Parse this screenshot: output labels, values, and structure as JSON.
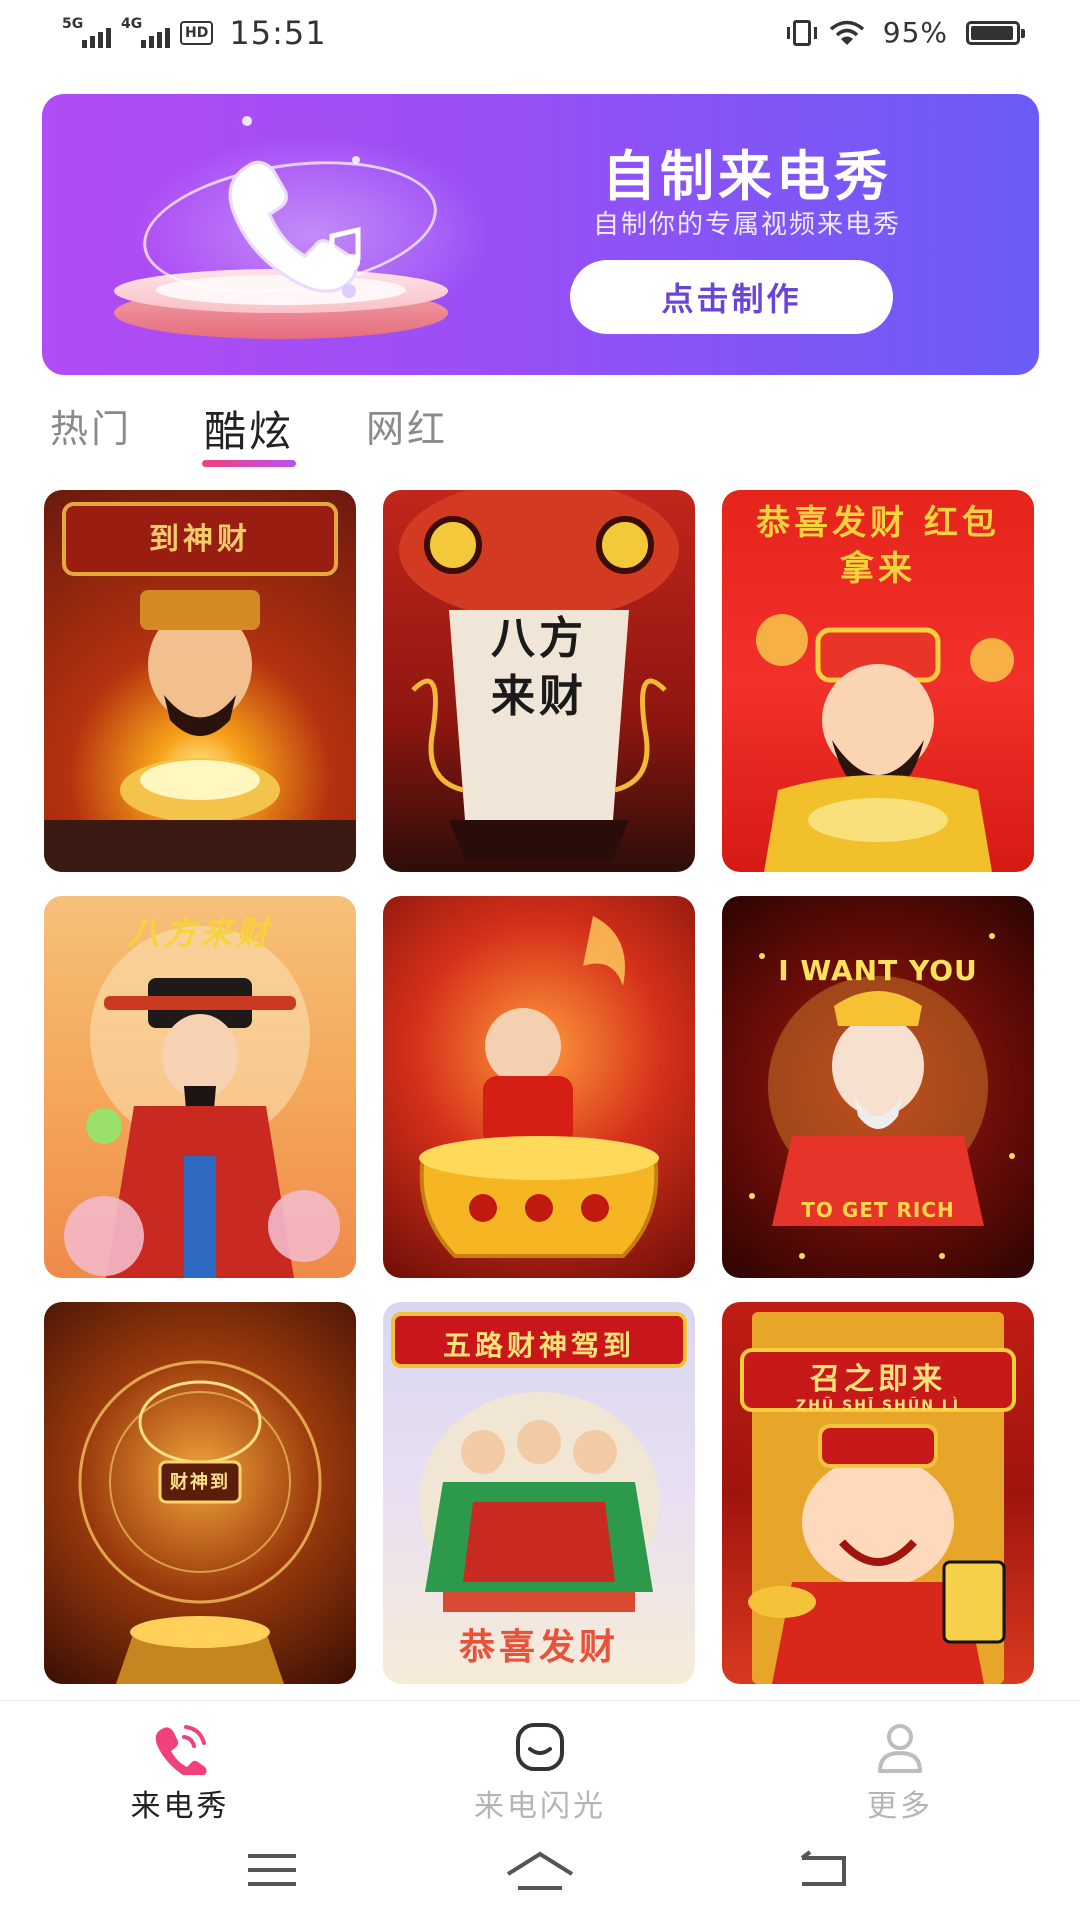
{
  "status_bar": {
    "net1": "5G",
    "net2": "4G",
    "hd": "HD",
    "time": "15:51",
    "battery_pct": "95%",
    "battery_level": 0.95
  },
  "banner": {
    "title": "自制来电秀",
    "subtitle": "自制你的专属视频来电秀",
    "button": "点击制作"
  },
  "tabs": [
    {
      "label": "热门",
      "active": false
    },
    {
      "label": "酷炫",
      "active": true
    },
    {
      "label": "网红",
      "active": false
    }
  ],
  "cards": [
    {
      "caption": "到神财"
    },
    {
      "caption": "八方来财"
    },
    {
      "caption": "恭喜发财 红包拿来"
    },
    {
      "caption": "八方来财"
    },
    {
      "caption": ""
    },
    {
      "caption": "I WANT YOU",
      "caption2": "TO GET RICH"
    },
    {
      "caption": "财神到"
    },
    {
      "caption": "五路财神驾到",
      "caption2": "恭喜发财"
    },
    {
      "caption": "召之即来",
      "caption2": "ZHŪ SHĪ SHŪN LÌ"
    }
  ],
  "bottom_nav": [
    {
      "label": "来电秀",
      "icon": "phone-icon",
      "active": true
    },
    {
      "label": "来电闪光",
      "icon": "flash-face-icon",
      "active": false
    },
    {
      "label": "更多",
      "icon": "person-icon",
      "active": false
    }
  ],
  "colors": {
    "banner_start": "#b24cf4",
    "banner_end": "#6a5cf7",
    "accent_pink": "#f2407a",
    "button_text": "#6a44d8"
  }
}
